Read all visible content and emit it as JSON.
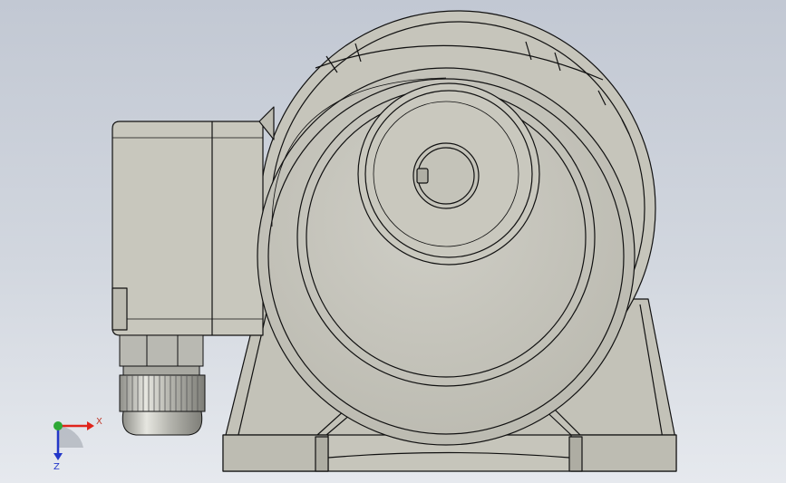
{
  "viewport": {
    "background_top": "#c2c8d3",
    "background_bottom": "#e6e9ee",
    "model": "gear-motor-front-view",
    "body_color": "#c9c8bf",
    "edge_color": "#111111"
  },
  "triad": {
    "x_label": "X",
    "z_label": "Z",
    "x_color": "#e0241b",
    "y_color": "#2ea836",
    "z_color": "#2337c9"
  }
}
